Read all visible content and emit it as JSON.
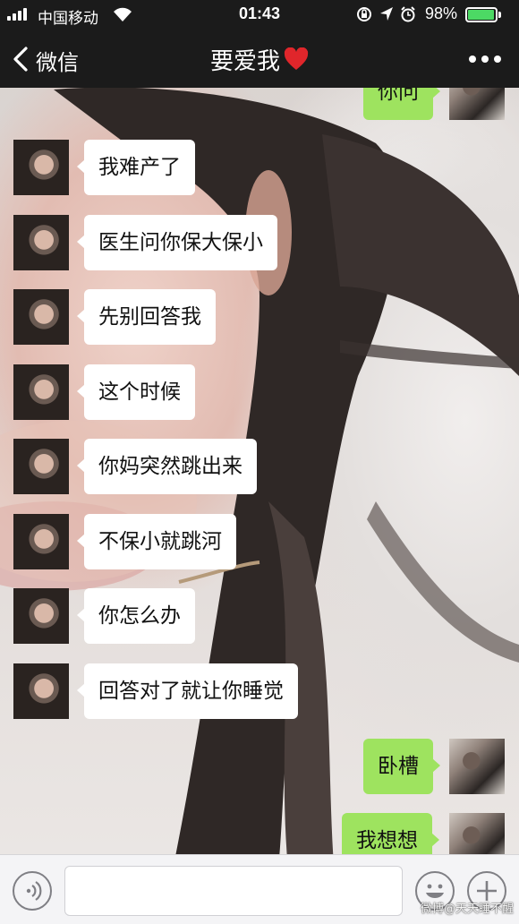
{
  "status_bar": {
    "carrier": "中国移动",
    "time": "01:43",
    "battery": "98%",
    "battery_level": 0.98,
    "icons": [
      "signal-icon",
      "wifi-icon",
      "orientation-lock-icon",
      "location-icon",
      "alarm-icon",
      "battery-icon"
    ]
  },
  "nav": {
    "back_label": "微信",
    "title": "要爱我",
    "title_emoji": "heart-icon",
    "more": "more-icon"
  },
  "messages": [
    {
      "from": "me",
      "text": "你问"
    },
    {
      "from": "other",
      "text": "我难产了"
    },
    {
      "from": "other",
      "text": "医生问你保大保小"
    },
    {
      "from": "other",
      "text": "先别回答我"
    },
    {
      "from": "other",
      "text": "这个时候"
    },
    {
      "from": "other",
      "text": "你妈突然跳出来"
    },
    {
      "from": "other",
      "text": "不保小就跳河"
    },
    {
      "from": "other",
      "text": "你怎么办"
    },
    {
      "from": "other",
      "text": "回答对了就让你睡觉"
    },
    {
      "from": "me",
      "text": "卧槽"
    },
    {
      "from": "me",
      "text": "我想想"
    }
  ],
  "input_bar": {
    "voice": "voice-icon",
    "emoji": "emoji-icon",
    "plus": "plus-icon",
    "text_value": ""
  },
  "watermark": "微博@天天睡不醒",
  "colors": {
    "bar_bg": "#1b1b1b",
    "outgoing_bubble": "#9ee35f",
    "incoming_bubble": "#ffffff",
    "battery_fill": "#4cd964",
    "heart": "#e0262b"
  }
}
